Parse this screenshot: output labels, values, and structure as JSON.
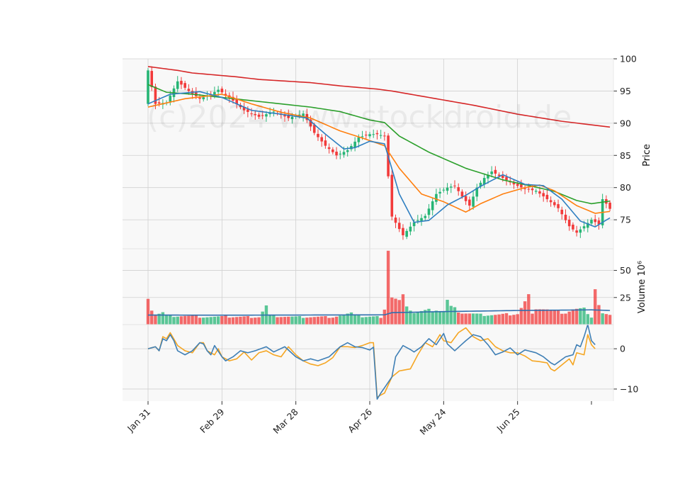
{
  "chart_data": {
    "type": "candlestick",
    "watermark": "(c)2024 www.stockdroid.de",
    "colors": {
      "up": "#26b575",
      "down": "#f23a3a",
      "panel_bg": "#f8f8f8",
      "grid": "#d0d0d0",
      "sma_fast": "#2f7fc1",
      "sma_mid": "#ff7f0e",
      "sma_slow": "#2ca02c",
      "sma_long": "#d62728",
      "volume_ma": "#2f6fae",
      "osc_line": "#3f7fb5",
      "osc_signal": "#f5a623"
    },
    "x_ticks": [
      "Jan 31",
      "Feb 29",
      "Mar 28",
      "Apr 26",
      "May 24",
      "Jun 25"
    ],
    "panels": [
      {
        "name": "price",
        "ylabel": "Price",
        "ylim": [
          70.5,
          100
        ],
        "yticks": [
          "75",
          "80",
          "85",
          "90",
          "95",
          "100"
        ]
      },
      {
        "name": "volume",
        "ylabel": "Volume  10⁶",
        "ylim": [
          0,
          70
        ],
        "yticks": [
          "25",
          "50"
        ]
      },
      {
        "name": "oscillator",
        "ylabel": "",
        "ylim": [
          -13,
          6
        ],
        "yticks": [
          "0",
          "−10"
        ]
      }
    ],
    "price_anchors": [
      [
        0,
        98.2
      ],
      [
        2,
        93.0
      ],
      [
        5,
        93.2
      ],
      [
        8,
        96.5
      ],
      [
        11,
        95.0
      ],
      [
        14,
        93.8
      ],
      [
        17,
        94.5
      ],
      [
        19,
        95.2
      ],
      [
        22,
        94.0
      ],
      [
        26,
        92.0
      ],
      [
        30,
        91.0
      ],
      [
        34,
        91.8
      ],
      [
        38,
        90.8
      ],
      [
        42,
        91.5
      ],
      [
        45,
        88.5
      ],
      [
        48,
        86.5
      ],
      [
        51,
        85.0
      ],
      [
        54,
        85.8
      ],
      [
        57,
        87.8
      ],
      [
        60,
        88.3
      ],
      [
        62,
        88.3
      ],
      [
        64,
        88.0
      ],
      [
        66,
        75.5
      ],
      [
        69,
        72.6
      ],
      [
        72,
        74.6
      ],
      [
        75,
        75.6
      ],
      [
        78,
        79.0
      ],
      [
        81,
        80.0
      ],
      [
        83,
        80.3
      ],
      [
        85,
        78.6
      ],
      [
        87,
        77.2
      ],
      [
        89,
        80.0
      ],
      [
        91,
        81.5
      ],
      [
        93,
        82.5
      ],
      [
        96,
        81.5
      ],
      [
        99,
        80.5
      ],
      [
        102,
        79.8
      ],
      [
        105,
        79.5
      ],
      [
        108,
        78.2
      ],
      [
        111,
        76.8
      ],
      [
        114,
        74.0
      ],
      [
        116,
        73.0
      ],
      [
        118,
        74.0
      ],
      [
        120,
        75.0
      ],
      [
        122,
        74.3
      ],
      [
        123,
        78.2
      ],
      [
        124,
        77.5
      ],
      [
        125,
        76.7
      ]
    ],
    "sma_anchors": {
      "fast": [
        [
          0,
          93.0
        ],
        [
          6,
          94.5
        ],
        [
          14,
          94.9
        ],
        [
          20,
          94.0
        ],
        [
          28,
          92.0
        ],
        [
          36,
          91.4
        ],
        [
          43,
          90.8
        ],
        [
          48,
          88.3
        ],
        [
          53,
          86.0
        ],
        [
          56,
          86.2
        ],
        [
          60,
          87.2
        ],
        [
          64,
          86.8
        ],
        [
          68,
          79.0
        ],
        [
          72,
          74.6
        ],
        [
          76,
          74.9
        ],
        [
          81,
          77.3
        ],
        [
          86,
          78.8
        ],
        [
          90,
          80.2
        ],
        [
          96,
          82.0
        ],
        [
          102,
          80.5
        ],
        [
          107,
          80.3
        ],
        [
          112,
          78.2
        ],
        [
          117,
          74.8
        ],
        [
          121,
          73.9
        ],
        [
          125,
          75.3
        ]
      ],
      "mid": [
        [
          0,
          92.5
        ],
        [
          10,
          93.8
        ],
        [
          20,
          94.5
        ],
        [
          28,
          93.0
        ],
        [
          36,
          91.7
        ],
        [
          44,
          90.8
        ],
        [
          52,
          88.8
        ],
        [
          58,
          87.7
        ],
        [
          64,
          86.5
        ],
        [
          68,
          83.0
        ],
        [
          74,
          79.0
        ],
        [
          80,
          77.8
        ],
        [
          86,
          76.2
        ],
        [
          90,
          77.5
        ],
        [
          96,
          79.0
        ],
        [
          102,
          80.0
        ],
        [
          106,
          80.4
        ],
        [
          110,
          79.5
        ],
        [
          116,
          77.2
        ],
        [
          121,
          76.0
        ],
        [
          125,
          76.3
        ]
      ],
      "slow": [
        [
          0,
          96.0
        ],
        [
          5,
          94.8
        ],
        [
          12,
          94.5
        ],
        [
          20,
          94.0
        ],
        [
          28,
          93.5
        ],
        [
          36,
          93.0
        ],
        [
          44,
          92.5
        ],
        [
          52,
          91.8
        ],
        [
          60,
          90.5
        ],
        [
          64,
          90.1
        ],
        [
          68,
          88.0
        ],
        [
          76,
          85.5
        ],
        [
          86,
          83.0
        ],
        [
          96,
          81.2
        ],
        [
          104,
          80.2
        ],
        [
          110,
          79.4
        ],
        [
          116,
          78.0
        ],
        [
          120,
          77.5
        ],
        [
          125,
          77.9
        ]
      ],
      "long": [
        [
          0,
          98.8
        ],
        [
          8,
          98.2
        ],
        [
          12,
          97.8
        ],
        [
          24,
          97.2
        ],
        [
          30,
          96.8
        ],
        [
          44,
          96.3
        ],
        [
          52,
          95.8
        ],
        [
          62,
          95.3
        ],
        [
          66,
          95.0
        ],
        [
          76,
          94.0
        ],
        [
          88,
          92.8
        ],
        [
          100,
          91.4
        ],
        [
          112,
          90.3
        ],
        [
          125,
          89.4
        ]
      ]
    },
    "volume_anchors": [
      [
        0,
        27
      ],
      [
        1,
        14
      ],
      [
        2,
        9
      ],
      [
        3,
        10
      ],
      [
        4,
        11
      ],
      [
        5,
        8
      ],
      [
        10,
        8
      ],
      [
        15,
        7
      ],
      [
        20,
        7
      ],
      [
        21,
        10
      ],
      [
        22,
        7
      ],
      [
        30,
        7
      ],
      [
        32,
        17
      ],
      [
        33,
        8
      ],
      [
        40,
        7
      ],
      [
        45,
        7
      ],
      [
        50,
        7
      ],
      [
        55,
        10
      ],
      [
        57,
        10
      ],
      [
        58,
        7
      ],
      [
        63,
        7
      ],
      [
        64,
        15
      ],
      [
        65,
        71
      ],
      [
        66,
        25
      ],
      [
        67,
        23
      ],
      [
        68,
        21
      ],
      [
        69,
        25
      ],
      [
        70,
        19
      ],
      [
        71,
        14
      ],
      [
        72,
        11
      ],
      [
        78,
        14
      ],
      [
        80,
        12
      ],
      [
        81,
        22
      ],
      [
        82,
        16
      ],
      [
        85,
        11
      ],
      [
        90,
        9
      ],
      [
        95,
        9
      ],
      [
        100,
        10
      ],
      [
        103,
        26
      ],
      [
        104,
        9
      ],
      [
        105,
        16
      ],
      [
        108,
        14
      ],
      [
        110,
        12
      ],
      [
        113,
        11
      ],
      [
        115,
        14
      ],
      [
        118,
        14
      ],
      [
        119,
        11
      ],
      [
        120,
        7
      ],
      [
        121,
        34
      ],
      [
        122,
        18
      ],
      [
        123,
        10
      ],
      [
        125,
        8
      ]
    ],
    "volume_ma_anchors": [
      [
        0,
        8.8
      ],
      [
        20,
        8.7
      ],
      [
        40,
        8.8
      ],
      [
        64,
        9.0
      ],
      [
        66,
        11.0
      ],
      [
        80,
        12.0
      ],
      [
        100,
        13.0
      ],
      [
        120,
        13.6
      ],
      [
        125,
        13.0
      ]
    ],
    "osc_anchors": [
      [
        0,
        0.0
      ],
      [
        2,
        0.5
      ],
      [
        3,
        -0.5
      ],
      [
        4,
        2.5
      ],
      [
        5,
        2.0
      ],
      [
        6,
        3.5
      ],
      [
        7,
        2.0
      ],
      [
        8,
        -0.5
      ],
      [
        10,
        -1.5
      ],
      [
        12,
        -0.5
      ],
      [
        14,
        1.5
      ],
      [
        15,
        1.2
      ],
      [
        16,
        -0.5
      ],
      [
        17,
        -1.5
      ],
      [
        18,
        0.8
      ],
      [
        20,
        -2.0
      ],
      [
        21,
        -3.0
      ],
      [
        23,
        -2.0
      ],
      [
        25,
        -0.5
      ],
      [
        27,
        -1.0
      ],
      [
        29,
        -0.5
      ],
      [
        32,
        0.5
      ],
      [
        34,
        -0.8
      ],
      [
        37,
        0.5
      ],
      [
        40,
        -2.0
      ],
      [
        42,
        -3.0
      ],
      [
        44,
        -2.5
      ],
      [
        46,
        -3.0
      ],
      [
        49,
        -2.0
      ],
      [
        52,
        0.5
      ],
      [
        54,
        1.5
      ],
      [
        56,
        0.5
      ],
      [
        58,
        0.3
      ],
      [
        60,
        -0.3
      ],
      [
        61,
        0.4
      ],
      [
        62,
        -12.5
      ],
      [
        63,
        -11.0
      ],
      [
        66,
        -7.0
      ],
      [
        67,
        -2.0
      ],
      [
        69,
        0.8
      ],
      [
        71,
        -0.2
      ],
      [
        72,
        -0.8
      ],
      [
        74,
        0.5
      ],
      [
        76,
        2.5
      ],
      [
        78,
        1.0
      ],
      [
        80,
        3.8
      ],
      [
        81,
        1.2
      ],
      [
        83,
        -0.5
      ],
      [
        86,
        2.0
      ],
      [
        88,
        3.5
      ],
      [
        90,
        3.0
      ],
      [
        92,
        1.0
      ],
      [
        94,
        -1.5
      ],
      [
        96,
        -0.8
      ],
      [
        98,
        0.2
      ],
      [
        100,
        -1.5
      ],
      [
        102,
        -0.3
      ],
      [
        105,
        -1.0
      ],
      [
        107,
        -2.0
      ],
      [
        109,
        -3.5
      ],
      [
        110,
        -4.0
      ],
      [
        113,
        -2.0
      ],
      [
        115,
        -1.5
      ],
      [
        116,
        1.0
      ],
      [
        117,
        0.5
      ],
      [
        118,
        3.0
      ],
      [
        119,
        6.0
      ],
      [
        120,
        2.0
      ],
      [
        121,
        1.0
      ]
    ],
    "osc_signal_anchors": [
      [
        0,
        0.0
      ],
      [
        2,
        0.5
      ],
      [
        3,
        -0.5
      ],
      [
        4,
        3.0
      ],
      [
        5,
        2.5
      ],
      [
        6,
        4.0
      ],
      [
        8,
        0.8
      ],
      [
        10,
        -0.5
      ],
      [
        12,
        -1.0
      ],
      [
        14,
        1.5
      ],
      [
        15,
        1.5
      ],
      [
        16,
        -0.5
      ],
      [
        18,
        -1.5
      ],
      [
        19,
        0.0
      ],
      [
        20,
        -2.0
      ],
      [
        22,
        -3.0
      ],
      [
        24,
        -2.5
      ],
      [
        26,
        -0.8
      ],
      [
        28,
        -2.8
      ],
      [
        30,
        -1.0
      ],
      [
        32,
        -0.5
      ],
      [
        34,
        -1.5
      ],
      [
        36,
        -2.0
      ],
      [
        38,
        0.5
      ],
      [
        40,
        -1.5
      ],
      [
        42,
        -3.0
      ],
      [
        44,
        -3.8
      ],
      [
        46,
        -4.2
      ],
      [
        48,
        -3.5
      ],
      [
        50,
        -2.2
      ],
      [
        52,
        0.5
      ],
      [
        54,
        0.5
      ],
      [
        56,
        0.3
      ],
      [
        58,
        0.8
      ],
      [
        60,
        1.5
      ],
      [
        61,
        1.5
      ],
      [
        62,
        -12.0
      ],
      [
        64,
        -11.0
      ],
      [
        66,
        -7.0
      ],
      [
        68,
        -5.5
      ],
      [
        71,
        -5.0
      ],
      [
        73,
        -1.5
      ],
      [
        75,
        1.5
      ],
      [
        77,
        0.5
      ],
      [
        79,
        3.5
      ],
      [
        80,
        2.0
      ],
      [
        82,
        1.5
      ],
      [
        84,
        4.0
      ],
      [
        86,
        5.2
      ],
      [
        88,
        3.0
      ],
      [
        90,
        2.0
      ],
      [
        92,
        2.5
      ],
      [
        94,
        0.5
      ],
      [
        96,
        -0.5
      ],
      [
        98,
        -1.0
      ],
      [
        100,
        -1.0
      ],
      [
        102,
        -1.8
      ],
      [
        104,
        -3.0
      ],
      [
        106,
        -3.2
      ],
      [
        108,
        -3.5
      ],
      [
        109,
        -5.0
      ],
      [
        110,
        -5.5
      ],
      [
        112,
        -4.0
      ],
      [
        114,
        -2.5
      ],
      [
        115,
        -4.0
      ],
      [
        116,
        -1.0
      ],
      [
        118,
        -1.5
      ],
      [
        119,
        3.5
      ],
      [
        120,
        1.0
      ],
      [
        121,
        0.0
      ]
    ]
  }
}
